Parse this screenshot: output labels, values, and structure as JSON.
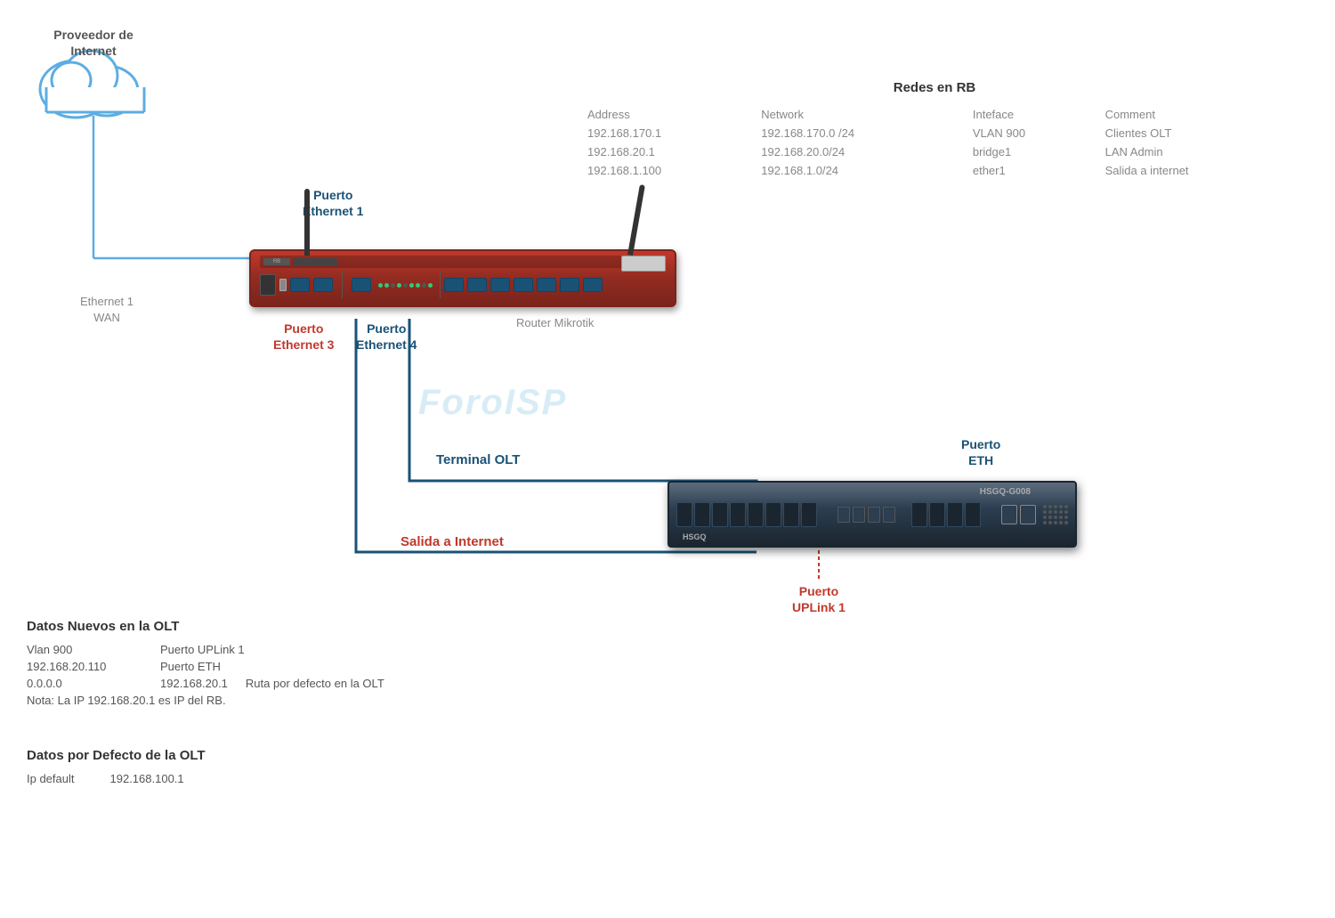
{
  "cloud": {
    "label_line1": "Proveedor de",
    "label_line2": "Internet"
  },
  "ethernet_wan": {
    "line1": "Ethernet 1",
    "line2": "WAN"
  },
  "router": {
    "label": "Router Mikrotik"
  },
  "port_labels": {
    "eth1_line1": "Puerto",
    "eth1_line2": "Ethernet 1",
    "eth3_line1": "Puerto",
    "eth3_line2": "Ethernet 3",
    "eth4_line1": "Puerto",
    "eth4_line2": "Ethernet 4",
    "eth_olt_line1": "Puerto",
    "eth_olt_line2": "ETH",
    "uplink_line1": "Puerto",
    "uplink_line2": "UPLink 1"
  },
  "connection_labels": {
    "terminal_olt": "Terminal OLT",
    "salida_internet": "Salida a Internet"
  },
  "watermark": "ForoISP",
  "redes_rb": {
    "title": "Redes en RB",
    "headers": {
      "address": "Address",
      "network": "Network",
      "interface": "Inteface",
      "comment": "Comment"
    },
    "rows": [
      {
        "address": "192.168.170.1",
        "network": "192.168.170.0 /24",
        "interface": "VLAN 900",
        "comment": "Clientes OLT"
      },
      {
        "address": "192.168.20.1",
        "network": "192.168.20.0/24",
        "interface": "bridge1",
        "comment": "LAN Admin"
      },
      {
        "address": "192.168.1.100",
        "network": "192.168.1.0/24",
        "interface": "ether1",
        "comment": "Salida a internet"
      }
    ]
  },
  "datos_nuevos": {
    "title": "Datos Nuevos en  la OLT",
    "rows": [
      {
        "key": "Vlan 900",
        "value": "Puerto UPLink 1"
      },
      {
        "key": "192.168.20.110",
        "value": "Puerto ETH"
      },
      {
        "key": "0.0.0.0",
        "value": "192.168.20.1",
        "extra": "Ruta  por defecto en la OLT"
      }
    ],
    "nota": "Nota: La IP 192.168.20.1 es IP del RB."
  },
  "datos_defecto": {
    "title": "Datos por Defecto de la OLT",
    "ip_key": "Ip default",
    "ip_value": "192.168.100.1"
  },
  "olt": {
    "brand": "HSGQ",
    "model": "HSGQ-G008"
  }
}
